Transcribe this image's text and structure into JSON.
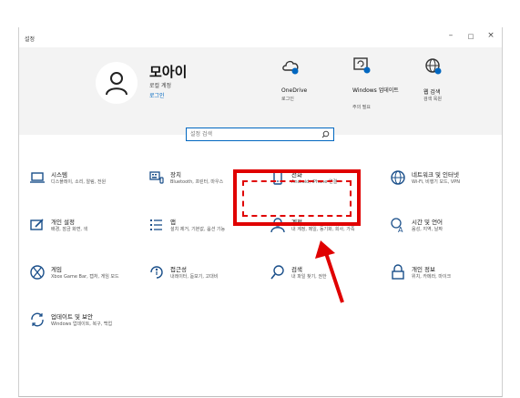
{
  "window": {
    "title": "설정",
    "controls": {
      "minimize": "–",
      "maximize": "□",
      "close": "×"
    }
  },
  "header": {
    "user": {
      "name": "모아이",
      "account_type": "로컬 계정",
      "login": "로그인"
    },
    "items": [
      {
        "label": "OneDrive",
        "sub": "로그인",
        "icon": "onedrive-icon"
      },
      {
        "label": "Windows 업데이트",
        "sub": "주의 필요",
        "icon": "windows-update-icon"
      },
      {
        "label": "웹 검색",
        "sub": "검색 옥원",
        "icon": "web-search-icon"
      }
    ]
  },
  "search": {
    "placeholder": "설정 검색"
  },
  "categories": [
    {
      "name": "시스템",
      "desc": "디스플레이, 소리, 알림, 전원",
      "icon": "laptop-icon"
    },
    {
      "name": "장치",
      "desc": "Bluetooth, 프린터, 마우스",
      "icon": "keyboard-icon"
    },
    {
      "name": "전화",
      "desc": "Android, iPhone 연결",
      "icon": "phone-icon"
    },
    {
      "name": "네트워크 및 인터넷",
      "desc": "Wi-Fi, 비행기 모드, VPN",
      "icon": "globe-icon"
    },
    {
      "name": "개인 설정",
      "desc": "배경, 잠금 화면, 색",
      "icon": "personalization-icon"
    },
    {
      "name": "앱",
      "desc": "설치 제거, 기본값, 옵션 기능",
      "icon": "apps-icon"
    },
    {
      "name": "계정",
      "desc": "내 계정, 메일, 동기화, 회사, 가족",
      "icon": "account-icon"
    },
    {
      "name": "시간 및 언어",
      "desc": "음성, 지역, 날짜",
      "icon": "time-language-icon"
    },
    {
      "name": "게임",
      "desc": "Xbox Game Bar, 캡처, 게임 모드",
      "icon": "xbox-icon"
    },
    {
      "name": "접근성",
      "desc": "내레이터, 돋보기, 고대비",
      "icon": "accessibility-icon"
    },
    {
      "name": "검색",
      "desc": "내 파일 찾기, 권한",
      "icon": "search-icon"
    },
    {
      "name": "개인 정보",
      "desc": "위치, 카메라, 마이크",
      "icon": "lock-icon"
    },
    {
      "name": "업데이트 및 보안",
      "desc": "Windows 업데이트, 복구, 백업",
      "icon": "sync-icon"
    }
  ],
  "colors": {
    "accent": "#0067c0",
    "highlight": "#e00000",
    "header_bg": "#f3f3f3"
  }
}
